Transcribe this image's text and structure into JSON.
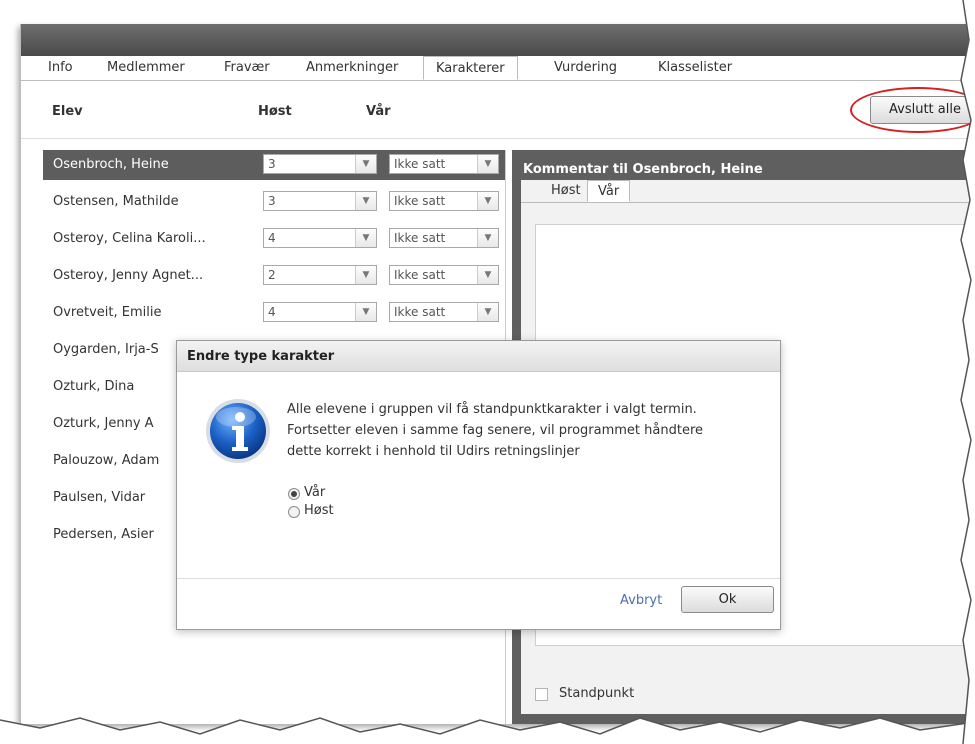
{
  "tabs": [
    "Info",
    "Medlemmer",
    "Fravær",
    "Anmerkninger",
    "Karakterer",
    "Vurdering",
    "Klasselister"
  ],
  "active_tab": "Karakterer",
  "header": {
    "col_student": "Elev",
    "col_autumn": "Høst",
    "col_spring": "Vår",
    "close_all_button": "Avslutt alle"
  },
  "students": [
    {
      "name": "Osenbroch, Heine",
      "autumn": "3",
      "spring": "Ikke satt",
      "selected": true
    },
    {
      "name": "Ostensen, Mathilde",
      "autumn": "3",
      "spring": "Ikke satt"
    },
    {
      "name": "Osteroy, Celina Karoli...",
      "autumn": "4",
      "spring": "Ikke satt"
    },
    {
      "name": "Osteroy, Jenny Agnet...",
      "autumn": "2",
      "spring": "Ikke satt"
    },
    {
      "name": "Ovretveit, Emilie",
      "autumn": "4",
      "spring": "Ikke satt"
    },
    {
      "name": "Oygarden, Irja-S"
    },
    {
      "name": "Ozturk, Dina"
    },
    {
      "name": "Ozturk, Jenny A"
    },
    {
      "name": "Palouzow, Adam"
    },
    {
      "name": "Paulsen, Vidar"
    },
    {
      "name": "Pedersen, Asier"
    }
  ],
  "comment_panel": {
    "title": "Kommentar til Osenbroch, Heine",
    "tabs": [
      "Høst",
      "Vår"
    ],
    "active_tab": "Vår",
    "checkbox_label": "Standpunkt"
  },
  "dialog": {
    "title": "Endre type karakter",
    "message_lines": [
      "Alle elevene i gruppen vil få standpunktkarakter i valgt termin.",
      "Fortsetter eleven i samme fag senere, vil programmet håndtere",
      "dette korrekt i henhold til Udirs retningslinjer"
    ],
    "options": [
      "Vår",
      "Høst"
    ],
    "selected_option": "Vår",
    "cancel_label": "Avbryt",
    "ok_label": "Ok"
  },
  "colors": {
    "highlight": "#d42020",
    "selected_row": "#5d5d5d",
    "link": "#4b6fae"
  }
}
